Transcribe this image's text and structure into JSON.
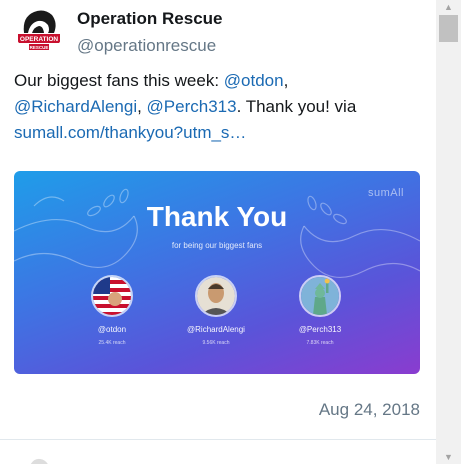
{
  "tweet": {
    "display_name": "Operation Rescue",
    "handle": "@operationrescue",
    "text": {
      "intro": "Our biggest fans this week: ",
      "mention1": "@otdon",
      "sep1": ", ",
      "mention2": "@RichardAlengi",
      "sep2": ", ",
      "mention3": "@Perch313",
      "outro": ". Thank you! via ",
      "link": "sumall.com/thankyou?utm_s…"
    },
    "timestamp": "Aug 24, 2018",
    "avatar_badge": "OPERATION RESCUE"
  },
  "media": {
    "brand": "sumAll",
    "title": "Thank You",
    "subtitle": "for being our biggest fans",
    "fans": [
      {
        "name": "@otdon",
        "reach": "25.4K reach"
      },
      {
        "name": "@RichardAlengi",
        "reach": "9.56K reach"
      },
      {
        "name": "@Perch313",
        "reach": "7.83K reach"
      }
    ]
  },
  "scrollbar": {
    "up_icon": "triangle-up-icon",
    "down_icon": "triangle-down-icon"
  },
  "colors": {
    "link": "#1b6ab3",
    "secondary_text": "#657786",
    "gradient_start": "#1f9de9",
    "gradient_end": "#8a3ccf"
  }
}
